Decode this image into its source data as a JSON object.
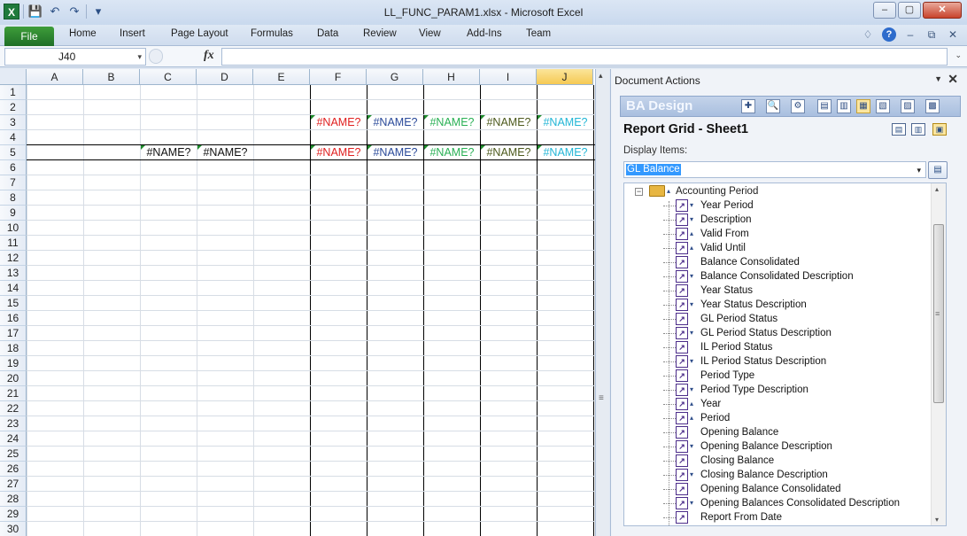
{
  "window": {
    "title": "LL_FUNC_PARAM1.xlsx - Microsoft Excel",
    "controls": {
      "minimize": "–",
      "restore": "▢",
      "close": "✕"
    }
  },
  "qat": {
    "app_icon": "X",
    "save": "💾",
    "undo": "↶",
    "redo": "↷",
    "customize": "▾"
  },
  "ribbon": {
    "file_tab": "File",
    "tabs": [
      "Home",
      "Insert",
      "Page Layout",
      "Formulas",
      "Data",
      "Review",
      "View",
      "Add-Ins",
      "Team"
    ],
    "right": {
      "collapse": "♢",
      "help": "?",
      "min": "–",
      "restore": "⧉",
      "close": "✕"
    }
  },
  "formula_bar": {
    "name_box": "J40",
    "name_box_arrow": "▾",
    "fx": "fx",
    "formula": "",
    "expand": "⌄"
  },
  "grid": {
    "columns": [
      "A",
      "B",
      "C",
      "D",
      "E",
      "F",
      "G",
      "H",
      "I",
      "J"
    ],
    "selected_column": "J",
    "rows": [
      "1",
      "2",
      "3",
      "4",
      "5",
      "6",
      "7",
      "8",
      "9",
      "10",
      "11",
      "12",
      "13",
      "14",
      "15",
      "16",
      "17",
      "18",
      "19",
      "20",
      "21",
      "22",
      "23",
      "24",
      "25",
      "26",
      "27",
      "28",
      "29",
      "30"
    ],
    "cells": {
      "F3": "#NAME?",
      "G3": "#NAME?",
      "H3": "#NAME?",
      "I3": "#NAME?",
      "J3": "#NAME?",
      "C5": "#NAME?",
      "D5": "#NAME?",
      "F5": "#NAME?",
      "G5": "#NAME?",
      "H5": "#NAME?",
      "I5": "#NAME?",
      "J5": "#NAME?"
    },
    "cell_colors": {
      "C": "#111111",
      "D": "#111111",
      "F": "#e02020",
      "G": "#2a4a9a",
      "H": "#2ab055",
      "I": "#4d5a1e",
      "J": "#23b6d6"
    },
    "split_up": "▴",
    "split_grip": "≡"
  },
  "pane": {
    "title": "Document Actions",
    "menu": "▼",
    "close": "✕",
    "ba_title": "BA Design",
    "toolbar_icons": [
      "✚",
      "🔍",
      "⚙",
      "▤",
      "▥",
      "▦",
      "▧",
      "▨",
      "▩"
    ],
    "grid_heading": "Report Grid - Sheet1",
    "layout_icons": [
      "▤",
      "▥",
      "▣"
    ],
    "display_label": "Display Items:",
    "display_value": "GL Balance",
    "display_arrow": "▾",
    "display_btn": "▤",
    "tree_root": {
      "expander": "−",
      "sort": "▴",
      "label": "Accounting Period"
    },
    "tree_items": [
      {
        "label": "Year Period",
        "sort": "▾"
      },
      {
        "label": "Description",
        "sort": "▾"
      },
      {
        "label": "Valid From",
        "sort": "▴"
      },
      {
        "label": "Valid Until",
        "sort": "▴"
      },
      {
        "label": "Balance Consolidated",
        "sort": ""
      },
      {
        "label": "Balance Consolidated Description",
        "sort": "▾"
      },
      {
        "label": "Year Status",
        "sort": ""
      },
      {
        "label": "Year Status Description",
        "sort": "▾"
      },
      {
        "label": "GL Period Status",
        "sort": ""
      },
      {
        "label": "GL Period Status Description",
        "sort": "▾"
      },
      {
        "label": "IL Period Status",
        "sort": ""
      },
      {
        "label": "IL Period Status Description",
        "sort": "▾"
      },
      {
        "label": "Period Type",
        "sort": ""
      },
      {
        "label": "Period Type Description",
        "sort": "▾"
      },
      {
        "label": "Year",
        "sort": "▴"
      },
      {
        "label": "Period",
        "sort": "▴"
      },
      {
        "label": "Opening Balance",
        "sort": ""
      },
      {
        "label": "Opening Balance Description",
        "sort": "▾"
      },
      {
        "label": "Closing Balance",
        "sort": ""
      },
      {
        "label": "Closing Balance Description",
        "sort": "▾"
      },
      {
        "label": "Opening Balance Consolidated",
        "sort": ""
      },
      {
        "label": "Opening Balances Consolidated Description",
        "sort": "▾"
      },
      {
        "label": "Report From Date",
        "sort": ""
      }
    ],
    "scroll": {
      "up": "▴",
      "down": "▾",
      "grip": "≡"
    }
  }
}
